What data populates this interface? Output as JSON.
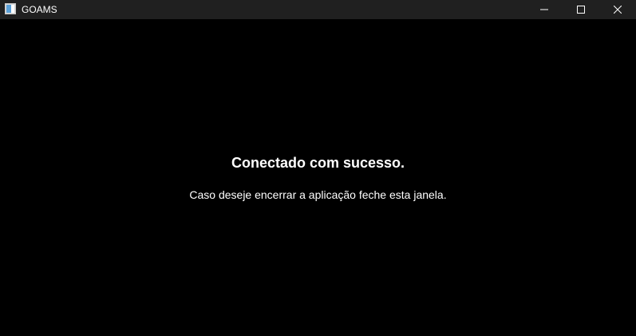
{
  "window": {
    "title": "GOAMS",
    "icon": "app-window-icon",
    "controls": {
      "minimize_icon": "minimize-icon",
      "maximize_icon": "maximize-icon",
      "close_icon": "close-icon"
    }
  },
  "main": {
    "heading": "Conectado com sucesso.",
    "message": "Caso deseje encerrar a aplicação feche esta janela."
  },
  "colors": {
    "background": "#000000",
    "titlebar": "#202020",
    "text": "#ffffff"
  }
}
